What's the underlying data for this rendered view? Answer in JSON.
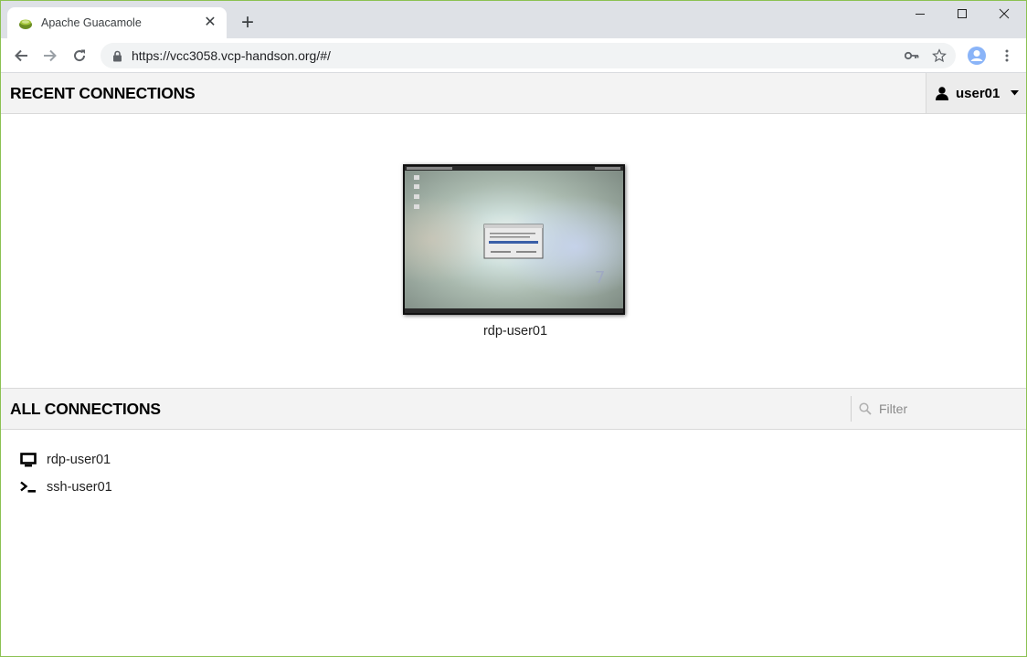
{
  "browser": {
    "tab_title": "Apache Guacamole",
    "url": "https://vcc3058.vcp-handson.org/#/"
  },
  "header": {
    "title": "RECENT CONNECTIONS",
    "username": "user01"
  },
  "recent": {
    "items": [
      {
        "label": "rdp-user01"
      }
    ]
  },
  "all_connections": {
    "title": "ALL CONNECTIONS",
    "filter_placeholder": "Filter",
    "items": [
      {
        "label": "rdp-user01",
        "icon": "monitor-icon"
      },
      {
        "label": "ssh-user01",
        "icon": "terminal-icon"
      }
    ]
  },
  "colors": {
    "frame": "#8cc152",
    "header_bg": "#f3f3f3",
    "tabstrip_bg": "#dee1e6"
  }
}
